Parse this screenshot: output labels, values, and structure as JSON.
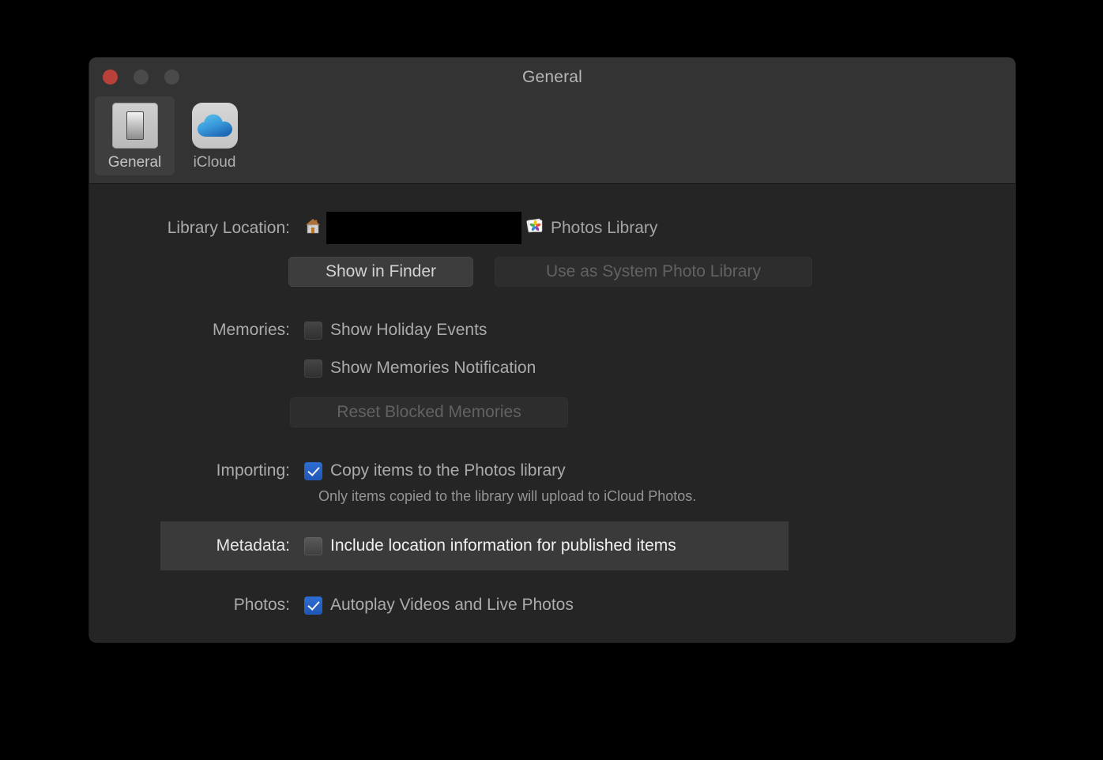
{
  "window": {
    "title": "General",
    "traffic_lights": [
      "close",
      "minimize",
      "zoom"
    ]
  },
  "toolbar": {
    "tabs": [
      {
        "label": "General",
        "icon": "switch-icon",
        "selected": true
      },
      {
        "label": "iCloud",
        "icon": "icloud-icon",
        "selected": false
      }
    ]
  },
  "content": {
    "library": {
      "label": "Library Location:",
      "path_value": "",
      "home_icon": "home-folder-icon",
      "library_icon": "photos-library-icon",
      "library_name": "Photos Library",
      "buttons": {
        "show_in_finder": "Show in Finder",
        "use_as_system": "Use as System Photo Library"
      }
    },
    "memories": {
      "label": "Memories:",
      "show_holiday_events": "Show Holiday Events",
      "show_memories_notification": "Show Memories Notification",
      "reset_button": "Reset Blocked Memories"
    },
    "importing": {
      "label": "Importing:",
      "copy_items": "Copy items to the Photos library",
      "note": "Only items copied to the library will upload to iCloud Photos."
    },
    "metadata": {
      "label": "Metadata:",
      "include_location": "Include location information for published items"
    },
    "photos": {
      "label": "Photos:",
      "autoplay": "Autoplay Videos and Live Photos"
    }
  },
  "colors": {
    "window_bg": "#252525",
    "titlebar_bg": "#333333",
    "accent_checked": "#2d6ed4",
    "highlight_row": "#3a3a3a",
    "close_button": "#b8413b"
  }
}
